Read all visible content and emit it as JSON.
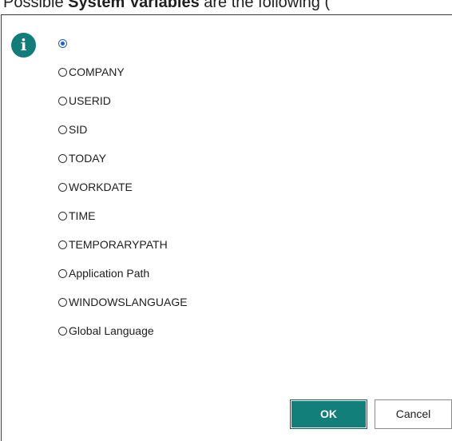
{
  "intro": {
    "prefix": "Possible ",
    "bold": "System Variables",
    "suffix": " are the following ("
  },
  "dialog": {
    "icon": "info-icon",
    "options": [
      {
        "label": "",
        "checked": true
      },
      {
        "label": "COMPANY",
        "checked": false
      },
      {
        "label": "USERID",
        "checked": false
      },
      {
        "label": "SID",
        "checked": false
      },
      {
        "label": "TODAY",
        "checked": false
      },
      {
        "label": "WORKDATE",
        "checked": false
      },
      {
        "label": "TIME",
        "checked": false
      },
      {
        "label": "TEMPORARYPATH",
        "checked": false
      },
      {
        "label": "Application Path",
        "checked": false
      },
      {
        "label": "WINDOWSLANGUAGE",
        "checked": false
      },
      {
        "label": "Global Language",
        "checked": false
      }
    ],
    "ok_label": "OK",
    "cancel_label": "Cancel"
  },
  "colors": {
    "accent": "#137f7a",
    "radio_selected": "#1a5fd0"
  }
}
